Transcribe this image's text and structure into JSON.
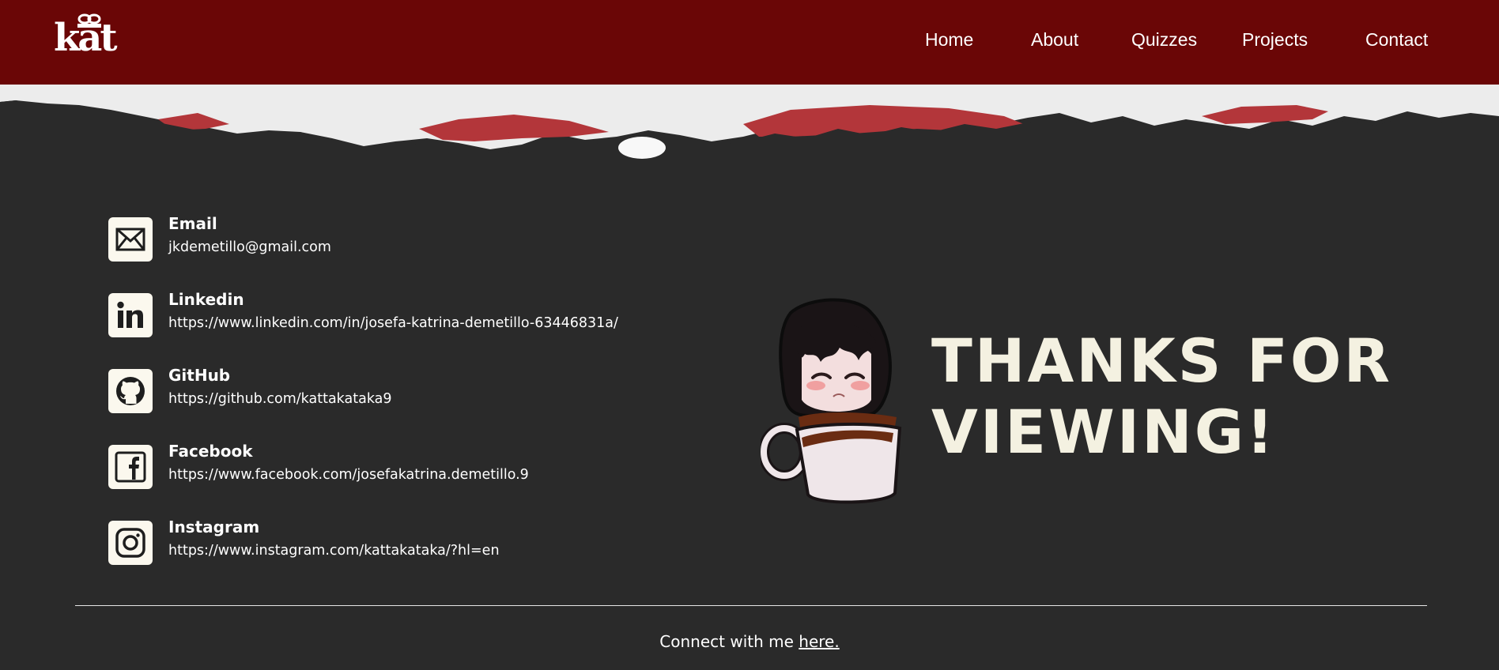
{
  "header": {
    "logo_text": "kat",
    "nav": [
      {
        "label": "Home"
      },
      {
        "label": "About"
      },
      {
        "label": "Quizzes"
      },
      {
        "label": "Projects"
      },
      {
        "label": "Contact"
      }
    ]
  },
  "contacts": [
    {
      "title": "Email",
      "value": "jkdemetillo@gmail.com",
      "icon": "envelope-icon"
    },
    {
      "title": "Linkedin",
      "value": "https://www.linkedin.com/in/josefa-katrina-demetillo-63446831a/",
      "icon": "linkedin-icon"
    },
    {
      "title": "GitHub",
      "value": "https://github.com/kattakataka9",
      "icon": "github-icon"
    },
    {
      "title": "Facebook",
      "value": "https://www.facebook.com/josefakatrina.demetillo.9",
      "icon": "facebook-icon"
    },
    {
      "title": "Instagram",
      "value": "https://www.instagram.com/kattakataka/?hl=en",
      "icon": "instagram-icon"
    }
  ],
  "thanks": {
    "line1": "THANKS FOR",
    "line2": "VIEWING!"
  },
  "footer": {
    "prefix": "Connect with me ",
    "link": "here."
  },
  "colors": {
    "header_bg": "#6a0606",
    "page_bg": "#2a2a2a",
    "paper": "#eeeeee",
    "paper_red": "#b3363a",
    "icon_bg": "#fbf8ee"
  }
}
